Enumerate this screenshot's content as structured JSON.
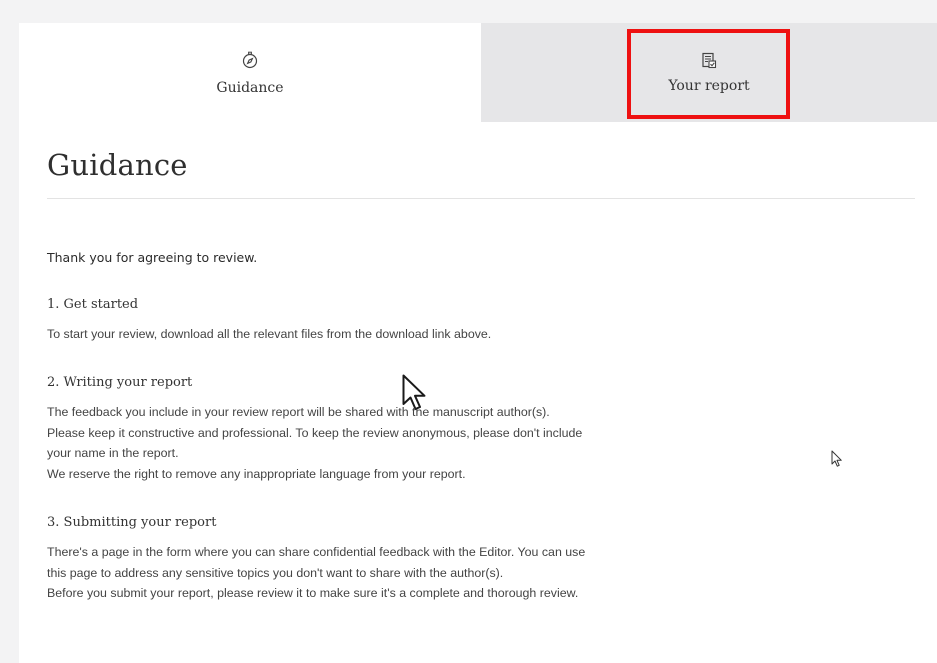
{
  "tabs": [
    {
      "label": "Guidance",
      "icon": "compass-icon",
      "active": true
    },
    {
      "label": "Your report",
      "icon": "report-document-icon",
      "active": false
    }
  ],
  "page": {
    "title": "Guidance",
    "intro": "Thank you for agreeing to review."
  },
  "sections": [
    {
      "heading": "1. Get started",
      "lines": [
        "To start your review, download all the relevant files from the download link above."
      ]
    },
    {
      "heading": "2. Writing your report",
      "lines": [
        "The feedback you include in your review report will be shared with the manuscript author(s).",
        "Please keep it constructive and professional. To keep the review anonymous, please don't include",
        "your name in the report.",
        "We reserve the right to remove any inappropriate language from your report."
      ]
    },
    {
      "heading": "3. Submitting your report",
      "lines": [
        "There's a page in the form where you can share confidential feedback with the Editor. You can use",
        "this page to address any sensitive topics you don't want to share with the author(s).",
        "Before you submit your report, please review it to make sure it's a complete and thorough review."
      ]
    }
  ],
  "colors": {
    "highlight": "#ee1111",
    "inactive_tab": "#e6e6e8"
  }
}
